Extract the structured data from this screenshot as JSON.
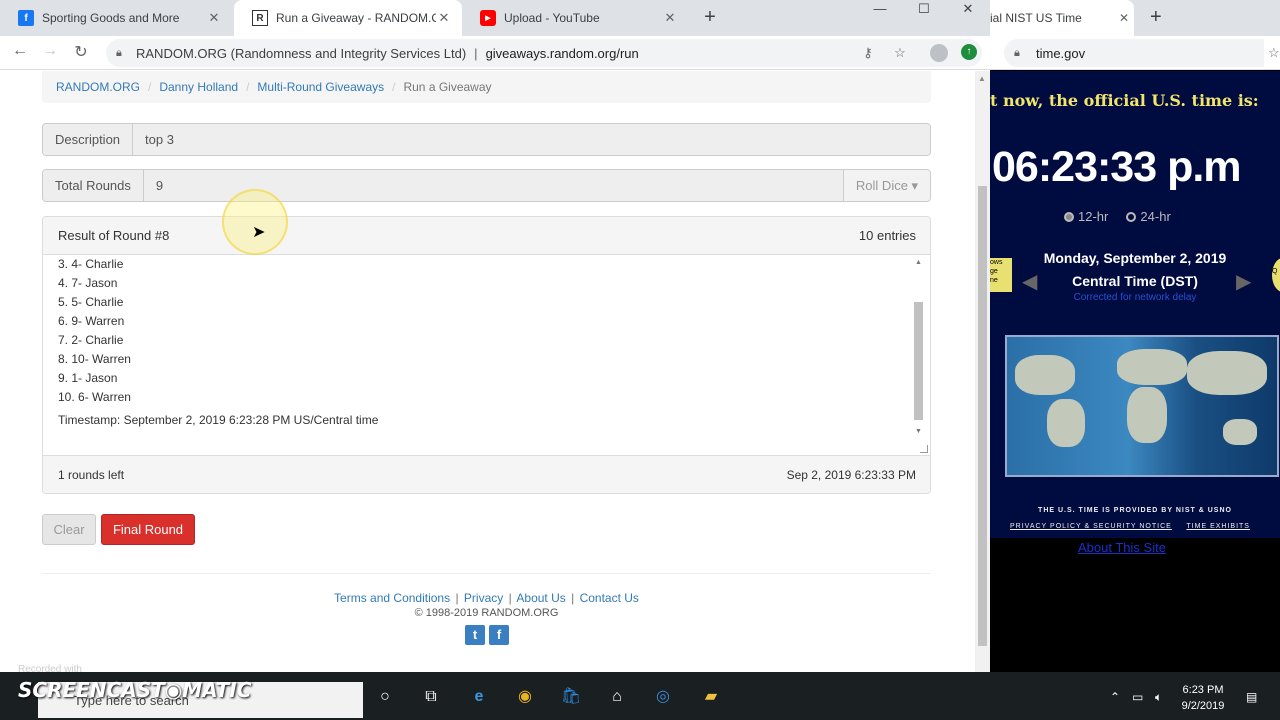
{
  "browser_left": {
    "tabs": [
      {
        "title": "Sporting Goods and More",
        "favicon": "facebook-favicon",
        "active": false
      },
      {
        "title": "Run a Giveaway - RANDOM.ORG",
        "favicon": "random-org-favicon",
        "active": true
      },
      {
        "title": "Upload - YouTube",
        "favicon": "youtube-favicon",
        "active": false
      }
    ],
    "address": {
      "cert": "RANDOM.ORG (Randomness and Integrity Services Ltd)",
      "separator": "|",
      "url": "giveaways.random.org/run"
    }
  },
  "page": {
    "breadcrumb": [
      "RANDOM.ORG",
      "Danny Holland",
      "Multi-Round Giveaways",
      "Run a Giveaway"
    ],
    "description_label": "Description",
    "description_value": "top 3",
    "rounds_label": "Total Rounds",
    "rounds_value": "9",
    "roll_dice": "Roll Dice ▾",
    "result_title": "Result of Round #8",
    "entries_count": "10 entries",
    "results": [
      "3. 4- Charlie",
      "4. 7- Jason",
      "5. 5- Charlie",
      "6. 9- Warren",
      "7. 2- Charlie",
      "8. 10- Warren",
      "9. 1- Jason",
      "10. 6- Warren"
    ],
    "timestamp": "Timestamp: September 2, 2019 6:23:28 PM US/Central time",
    "rounds_left": "1 rounds left",
    "current_time": "Sep 2, 2019 6:23:33 PM",
    "clear_button": "Clear",
    "final_button": "Final Round",
    "footer_links": [
      "Terms and Conditions",
      "Privacy",
      "About Us",
      "Contact Us"
    ],
    "copyright": "© 1998-2019 RANDOM.ORG"
  },
  "browser_right": {
    "tab_title": "ial NIST US Time",
    "url": "time.gov",
    "banner": "t now, the official U.S. time is:",
    "time": "06:23:33 p.m",
    "radio_12": "12-hr",
    "radio_24": "24-hr",
    "date": "Monday, September 2, 2019",
    "zone": "Central Time (DST)",
    "corrected": "Corrected for network delay",
    "nist_note": "THE U.S. TIME IS PROVIDED BY NIST & USNO",
    "privacy": "PRIVACY POLICY & SECURITY NOTICE",
    "exhibits": "TIME EXHIBITS",
    "about": "About This Site"
  },
  "taskbar": {
    "search_placeholder": "Type here to search",
    "time": "6:23 PM",
    "date": "9/2/2019"
  },
  "overlay": {
    "watermark": "SCREENCAST◉MATIC",
    "recorded": "Recorded with"
  }
}
